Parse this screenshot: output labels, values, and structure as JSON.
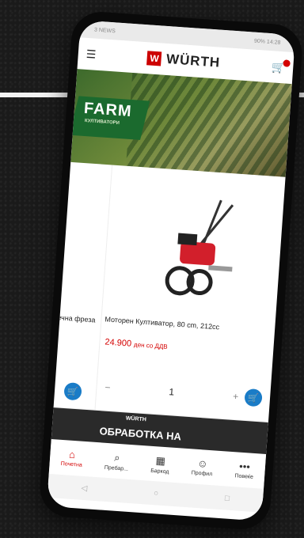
{
  "status": {
    "left": "3 NEWS",
    "right": "90% 14:28"
  },
  "header": {
    "menu_icon": "☰",
    "brand": "WÜRTH",
    "logo_mark": "W",
    "cart_icon": "🛒"
  },
  "banner": {
    "title": "FARM",
    "subtitle": "КУЛТИВАТОРИ"
  },
  "products": [
    {
      "name": "печна фреза"
    },
    {
      "name": "Моторен Култиватор, 80 cm, 212cc",
      "price": "24.900",
      "price_suffix": "ден со ДДВ",
      "qty": "1"
    }
  ],
  "promo": {
    "brand": "WÜRTH",
    "text": "ОБРАБОТКА НА"
  },
  "tabs": [
    {
      "label": "Почетна",
      "icon": "⌂"
    },
    {
      "label": "Пребар...",
      "icon": "⌕"
    },
    {
      "label": "Баркод",
      "icon": "▦"
    },
    {
      "label": "Профил",
      "icon": "☺"
    },
    {
      "label": "Повеќе",
      "icon": "•••"
    }
  ],
  "nav": {
    "back": "◁",
    "home": "○",
    "recent": "□"
  },
  "colors": {
    "brand_red": "#d40000",
    "cart_blue": "#1a7cc7"
  }
}
